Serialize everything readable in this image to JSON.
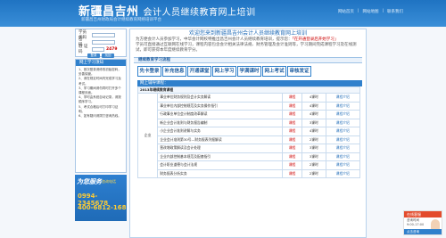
{
  "header": {
    "logo": "新疆昌吉州",
    "logo_sub": "会计人员继续教育网上培训",
    "tagline": "新疆昌吉州财政局会计继续教育网络培训平台",
    "links": [
      "网站首页",
      "网站地图",
      "联系我们"
    ]
  },
  "login": {
    "account_label": "学员代码",
    "password_label": "密　码",
    "code_label": "验 证 码",
    "code_value": "2479",
    "login_btn": "登录",
    "reset_btn": "找回"
  },
  "notice": {
    "title": "网上学习须知",
    "lines": [
      "1、首次登录请修改初始密码，妥善保管。",
      "2、请在规定时间内完成学习及考试。",
      "3、学习期间请勿同时打开多个课程页面。",
      "4、学时由系统自动记录，请按顺序学习。",
      "5、考试合格后可打印学习证明。",
      "6、如有疑问请拨打咨询热线。"
    ]
  },
  "hotline": {
    "label": "为您服务",
    "sub": "咨询电话",
    "phone1": "0994-2345678",
    "phone2": "400-6812-168"
  },
  "welcome": {
    "title": "欢迎您来到新疆昌吉州会计人员继续教育网上培训",
    "body1": "为方便会计人员参加学习，中华会计网校特推出昌吉州会计人员继续教育培训，提示您：",
    "highlight": "「在开通登录后开始学习」",
    "body2": "学员可直接通过互联网在线学习，课程内容包含会计相关法律法规、财务管理及会计准则等，学习期间完成课程学习及在线测试，即可获得本年度继续教育学分。"
  },
  "process_title": "继续教育学习流程",
  "steps": [
    "先卡登录",
    "补充信息",
    "开通课堂",
    "网上学习",
    "学满课时",
    "网上考试",
    "审核发证"
  ],
  "courses": {
    "title": "网上辅导课程：",
    "year_label": "2013年继续教育课程",
    "category": "企业",
    "rows": [
      {
        "name": "事业单位财务规则及会计实务解读",
        "status": "课程",
        "hours": "4课时",
        "action": "课程介绍"
      },
      {
        "name": "事业单位内部控制规范及实务操作指引",
        "status": "课程",
        "hours": "4课时",
        "action": "课程介绍"
      },
      {
        "name": "行政事业单位会计制度改革解读",
        "status": "课程",
        "hours": "4课时",
        "action": "课程介绍"
      },
      {
        "name": "新企业会计准则与财务报告编制",
        "status": "课程",
        "hours": "3课时",
        "action": "课程介绍"
      },
      {
        "name": "小企业会计准则讲解与实务",
        "status": "课程",
        "hours": "4课时",
        "action": "课程介绍"
      },
      {
        "name": "企业会计准则第30号—财务报表列报解读",
        "status": "课程",
        "hours": "2课时",
        "action": "课程介绍"
      },
      {
        "name": "营改增政策解读及会计处理",
        "status": "课程",
        "hours": "3课时",
        "action": "课程介绍"
      },
      {
        "name": "企业内部控制基本规范及配套指引",
        "status": "课程",
        "hours": "3课时",
        "action": "课程介绍"
      },
      {
        "name": "会计职业道德与会计法规",
        "status": "课程",
        "hours": "2课时",
        "action": "课程介绍"
      },
      {
        "name": "财务报表分析实务",
        "status": "课程",
        "hours": "2课时",
        "action": "课程介绍"
      }
    ]
  },
  "widget": {
    "title": "在线客服",
    "line1": "咨询时间",
    "line2": "9:00-17:00",
    "footer": "点击咨询"
  }
}
